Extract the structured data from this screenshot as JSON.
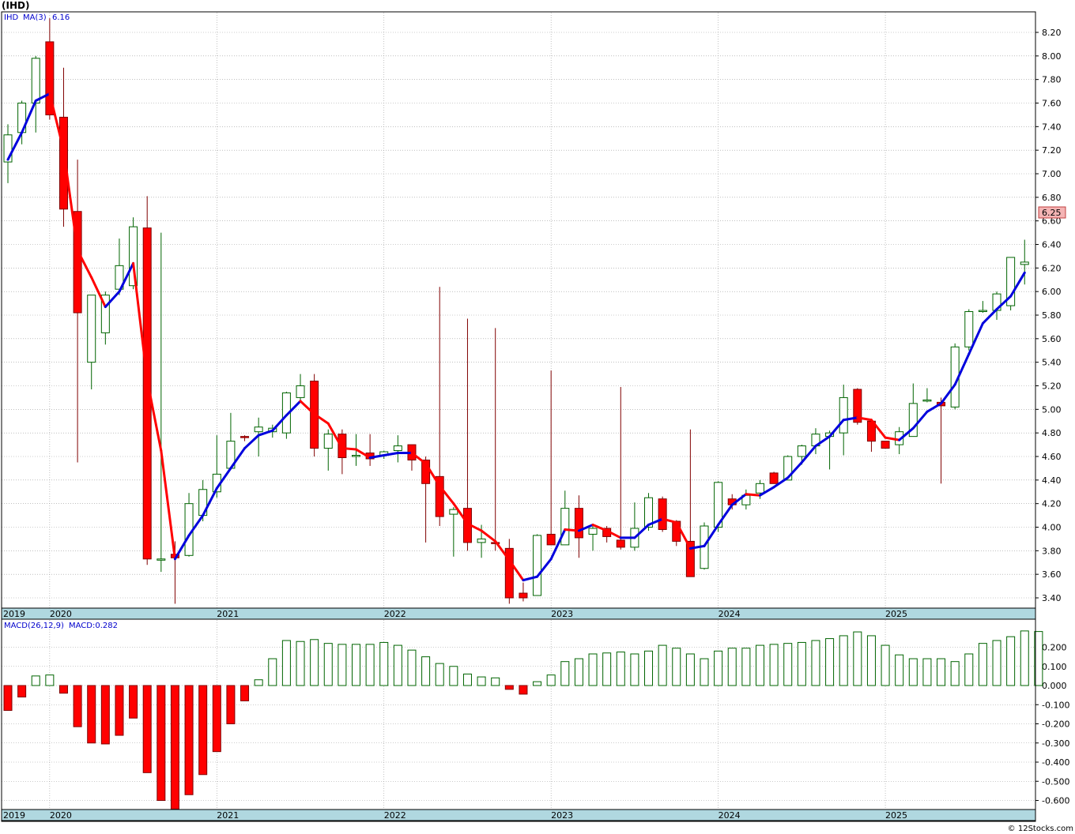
{
  "title": "(IHD)",
  "price_legend": {
    "symbol": "IHD",
    "ma_label": "MA(3)",
    "ma_value": "6.16"
  },
  "macd_legend": {
    "label": "MACD(26,12,9)",
    "value_label": "MACD:0.282"
  },
  "last_price_tag": "6.25",
  "credit": "© 12Stocks.com",
  "colors": {
    "up_fill": "#ffffff",
    "up_stroke": "#006400",
    "down_fill": "#ff0000",
    "down_stroke": "#800000",
    "ma_up": "#0000dd",
    "ma_down": "#ff0000",
    "axis_band": "#b0d8e0",
    "grid": "#999999",
    "price_tag": "#f4b4b4"
  },
  "chart_data": [
    {
      "type": "candlestick",
      "interval": "monthly",
      "ylim": [
        3.35,
        8.35
      ],
      "y_ticks": [
        "3.40",
        "3.60",
        "3.80",
        "4.00",
        "4.20",
        "4.40",
        "4.60",
        "4.80",
        "5.00",
        "5.20",
        "5.40",
        "5.60",
        "5.80",
        "6.00",
        "6.20",
        "6.40",
        "6.60",
        "6.80",
        "7.00",
        "7.20",
        "7.40",
        "7.60",
        "7.80",
        "8.00",
        "8.20"
      ],
      "year_labels": [
        "2019",
        "2020",
        "2021",
        "2022",
        "2023",
        "2024",
        "2025"
      ],
      "x_start": "2019-10",
      "bars": [
        {
          "o": 7.1,
          "h": 7.42,
          "l": 6.92,
          "c": 7.33
        },
        {
          "o": 7.35,
          "h": 7.62,
          "l": 7.25,
          "c": 7.6
        },
        {
          "o": 7.6,
          "h": 8.0,
          "l": 7.35,
          "c": 7.98
        },
        {
          "o": 8.12,
          "h": 8.32,
          "l": 7.46,
          "c": 7.5
        },
        {
          "o": 7.48,
          "h": 7.9,
          "l": 6.55,
          "c": 6.7
        },
        {
          "o": 6.68,
          "h": 7.12,
          "l": 4.55,
          "c": 5.82
        },
        {
          "o": 5.4,
          "h": 5.94,
          "l": 5.17,
          "c": 5.97
        },
        {
          "o": 5.65,
          "h": 6.0,
          "l": 5.55,
          "c": 5.97
        },
        {
          "o": 6.02,
          "h": 6.45,
          "l": 5.97,
          "c": 6.22
        },
        {
          "o": 6.05,
          "h": 6.63,
          "l": 6.02,
          "c": 6.55
        },
        {
          "o": 6.54,
          "h": 6.81,
          "l": 3.68,
          "c": 3.73
        },
        {
          "o": 3.73,
          "h": 6.5,
          "l": 3.62,
          "c": 3.73
        },
        {
          "o": 3.77,
          "h": 3.88,
          "l": 3.35,
          "c": 3.74
        },
        {
          "o": 3.76,
          "h": 4.29,
          "l": 3.75,
          "c": 4.2
        },
        {
          "o": 4.1,
          "h": 4.4,
          "l": 4.05,
          "c": 4.32
        },
        {
          "o": 4.3,
          "h": 4.78,
          "l": 4.25,
          "c": 4.45
        },
        {
          "o": 4.5,
          "h": 4.97,
          "l": 4.5,
          "c": 4.73
        },
        {
          "o": 4.77,
          "h": 4.78,
          "l": 4.73,
          "c": 4.76
        },
        {
          "o": 4.81,
          "h": 4.93,
          "l": 4.6,
          "c": 4.85
        },
        {
          "o": 4.81,
          "h": 4.87,
          "l": 4.76,
          "c": 4.84
        },
        {
          "o": 4.8,
          "h": 5.15,
          "l": 4.75,
          "c": 5.14
        },
        {
          "o": 5.1,
          "h": 5.3,
          "l": 5.08,
          "c": 5.2
        },
        {
          "o": 5.24,
          "h": 5.3,
          "l": 4.6,
          "c": 4.67
        },
        {
          "o": 4.67,
          "h": 4.83,
          "l": 4.48,
          "c": 4.79
        },
        {
          "o": 4.79,
          "h": 4.83,
          "l": 4.45,
          "c": 4.59
        },
        {
          "o": 4.61,
          "h": 4.79,
          "l": 4.52,
          "c": 4.61
        },
        {
          "o": 4.63,
          "h": 4.79,
          "l": 4.52,
          "c": 4.58
        },
        {
          "o": 4.61,
          "h": 4.65,
          "l": 4.58,
          "c": 4.64
        },
        {
          "o": 4.65,
          "h": 4.78,
          "l": 4.55,
          "c": 4.69
        },
        {
          "o": 4.7,
          "h": 4.7,
          "l": 4.48,
          "c": 4.57
        },
        {
          "o": 4.57,
          "h": 4.6,
          "l": 3.87,
          "c": 4.37
        },
        {
          "o": 4.43,
          "h": 6.04,
          "l": 4.01,
          "c": 4.09
        },
        {
          "o": 4.11,
          "h": 4.17,
          "l": 3.75,
          "c": 4.15
        },
        {
          "o": 4.16,
          "h": 5.77,
          "l": 3.8,
          "c": 3.87
        },
        {
          "o": 3.87,
          "h": 4.02,
          "l": 3.74,
          "c": 3.9
        },
        {
          "o": 3.87,
          "h": 5.69,
          "l": 3.8,
          "c": 3.86
        },
        {
          "o": 3.82,
          "h": 3.9,
          "l": 3.35,
          "c": 3.4
        },
        {
          "o": 3.44,
          "h": 3.53,
          "l": 3.37,
          "c": 3.4
        },
        {
          "o": 3.42,
          "h": 3.94,
          "l": 3.42,
          "c": 3.93
        },
        {
          "o": 3.94,
          "h": 5.33,
          "l": 3.85,
          "c": 3.85
        },
        {
          "o": 3.85,
          "h": 4.31,
          "l": 3.85,
          "c": 4.16
        },
        {
          "o": 4.16,
          "h": 4.27,
          "l": 3.74,
          "c": 3.91
        },
        {
          "o": 3.94,
          "h": 4.02,
          "l": 3.8,
          "c": 3.99
        },
        {
          "o": 3.99,
          "h": 4.01,
          "l": 3.87,
          "c": 3.92
        },
        {
          "o": 3.89,
          "h": 5.19,
          "l": 3.81,
          "c": 3.83
        },
        {
          "o": 3.83,
          "h": 4.21,
          "l": 3.8,
          "c": 3.99
        },
        {
          "o": 4.0,
          "h": 4.29,
          "l": 3.97,
          "c": 4.25
        },
        {
          "o": 4.24,
          "h": 4.26,
          "l": 3.96,
          "c": 3.98
        },
        {
          "o": 4.05,
          "h": 4.06,
          "l": 3.84,
          "c": 3.88
        },
        {
          "o": 3.88,
          "h": 4.83,
          "l": 3.61,
          "c": 3.58
        },
        {
          "o": 3.65,
          "h": 4.04,
          "l": 3.64,
          "c": 4.01
        },
        {
          "o": 4.0,
          "h": 4.39,
          "l": 3.96,
          "c": 4.38
        },
        {
          "o": 4.24,
          "h": 4.28,
          "l": 4.15,
          "c": 4.19
        },
        {
          "o": 4.19,
          "h": 4.32,
          "l": 4.15,
          "c": 4.27
        },
        {
          "o": 4.29,
          "h": 4.4,
          "l": 4.24,
          "c": 4.37
        },
        {
          "o": 4.46,
          "h": 4.47,
          "l": 4.37,
          "c": 4.37
        },
        {
          "o": 4.4,
          "h": 4.61,
          "l": 4.4,
          "c": 4.6
        },
        {
          "o": 4.6,
          "h": 4.7,
          "l": 4.53,
          "c": 4.69
        },
        {
          "o": 4.69,
          "h": 4.84,
          "l": 4.62,
          "c": 4.79
        },
        {
          "o": 4.77,
          "h": 4.82,
          "l": 4.49,
          "c": 4.8
        },
        {
          "o": 4.8,
          "h": 5.21,
          "l": 4.61,
          "c": 5.1
        },
        {
          "o": 5.17,
          "h": 5.18,
          "l": 4.87,
          "c": 4.89
        },
        {
          "o": 4.9,
          "h": 4.92,
          "l": 4.64,
          "c": 4.73
        },
        {
          "o": 4.73,
          "h": 4.73,
          "l": 4.67,
          "c": 4.67
        },
        {
          "o": 4.7,
          "h": 4.85,
          "l": 4.62,
          "c": 4.81
        },
        {
          "o": 4.77,
          "h": 5.22,
          "l": 4.77,
          "c": 5.05
        },
        {
          "o": 5.07,
          "h": 5.18,
          "l": 5.06,
          "c": 5.08
        },
        {
          "o": 5.06,
          "h": 5.1,
          "l": 4.37,
          "c": 5.03
        },
        {
          "o": 5.02,
          "h": 5.56,
          "l": 5.0,
          "c": 5.53
        },
        {
          "o": 5.53,
          "h": 5.85,
          "l": 5.5,
          "c": 5.83
        },
        {
          "o": 5.84,
          "h": 5.92,
          "l": 5.82,
          "c": 5.84
        },
        {
          "o": 5.84,
          "h": 6.0,
          "l": 5.76,
          "c": 5.98
        },
        {
          "o": 5.88,
          "h": 6.29,
          "l": 5.84,
          "c": 6.29
        },
        {
          "o": 6.23,
          "h": 6.44,
          "l": 6.06,
          "c": 6.25
        }
      ],
      "ma3": [
        7.12,
        7.35,
        7.62,
        7.68,
        7.2,
        6.35,
        6.12,
        5.87,
        6.0,
        6.24,
        5.25,
        4.65,
        3.73,
        3.93,
        4.1,
        4.33,
        4.5,
        4.67,
        4.78,
        4.82,
        4.95,
        5.07,
        4.96,
        4.88,
        4.67,
        4.66,
        4.59,
        4.61,
        4.63,
        4.63,
        4.54,
        4.35,
        4.2,
        4.03,
        3.97,
        3.88,
        3.72,
        3.55,
        3.58,
        3.73,
        3.98,
        3.97,
        4.02,
        3.97,
        3.91,
        3.91,
        4.02,
        4.07,
        4.04,
        3.82,
        3.84,
        4.02,
        4.19,
        4.28,
        4.27,
        4.34,
        4.42,
        4.55,
        4.69,
        4.77,
        4.91,
        4.93,
        4.91,
        4.76,
        4.74,
        4.84,
        4.98,
        5.05,
        5.21,
        5.47,
        5.73,
        5.85,
        5.96,
        6.16
      ]
    },
    {
      "type": "bar",
      "title": "MACD(26,12,9)",
      "ylim": [
        -0.645,
        0.285
      ],
      "y_ticks": [
        "0.200",
        "0.100",
        "0.000",
        "-0.100",
        "-0.200",
        "-0.300",
        "-0.400",
        "-0.500",
        "-0.600"
      ],
      "values": [
        -0.13,
        -0.06,
        0.05,
        0.055,
        -0.04,
        -0.215,
        -0.3,
        -0.305,
        -0.26,
        -0.17,
        -0.455,
        -0.6,
        -0.645,
        -0.57,
        -0.465,
        -0.345,
        -0.2,
        -0.08,
        0.03,
        0.14,
        0.235,
        0.23,
        0.24,
        0.22,
        0.215,
        0.215,
        0.215,
        0.225,
        0.21,
        0.185,
        0.15,
        0.115,
        0.1,
        0.06,
        0.045,
        0.04,
        -0.02,
        -0.045,
        0.02,
        0.055,
        0.125,
        0.14,
        0.165,
        0.17,
        0.175,
        0.165,
        0.18,
        0.21,
        0.195,
        0.165,
        0.14,
        0.18,
        0.195,
        0.195,
        0.21,
        0.215,
        0.22,
        0.225,
        0.235,
        0.245,
        0.26,
        0.28,
        0.26,
        0.21,
        0.16,
        0.14,
        0.14,
        0.14,
        0.125,
        0.165,
        0.22,
        0.235,
        0.255,
        0.285,
        0.282
      ]
    }
  ]
}
